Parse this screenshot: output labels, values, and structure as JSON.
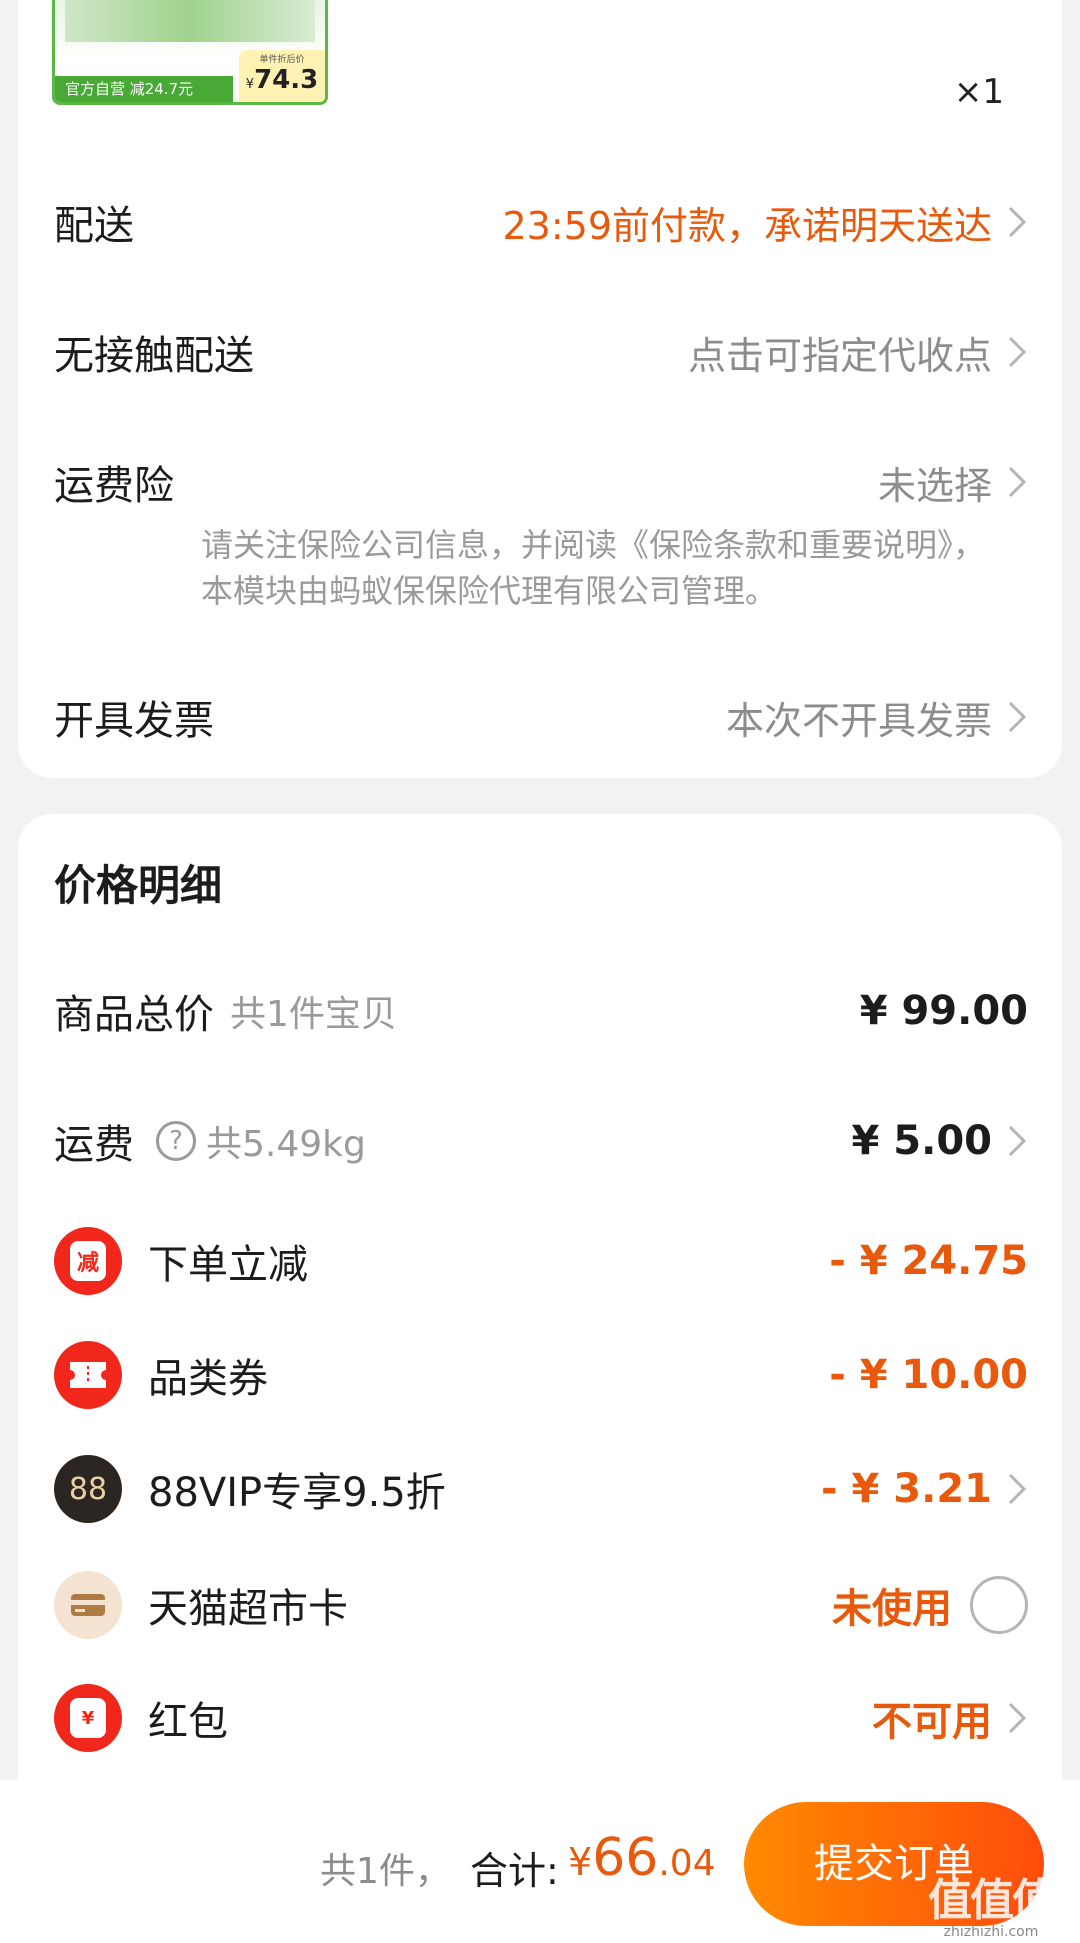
{
  "product": {
    "tag": "官方自营  减24.7元",
    "price_label": "单件折后价",
    "price_yen": "¥",
    "price": "74.3",
    "quantity": "×1"
  },
  "order_options": [
    {
      "label": "配送",
      "value": "23:59前付款，承诺明天送达"
    },
    {
      "label": "无接触配送",
      "value": "点击可指定代收点"
    },
    {
      "label": "运费险",
      "value": "未选择"
    },
    {
      "label": "开具发票",
      "value": "本次不开具发票"
    }
  ],
  "insurance_note": "请关注保险公司信息，并阅读《保险条款和重要说明》，本模块由蚂蚁保保险代理有限公司管理。",
  "price_detail": {
    "title": "价格明细",
    "goods_total": {
      "label": "商品总价",
      "sub": "共1件宝贝",
      "amount": "¥ 99.00"
    },
    "shipping": {
      "label": "运费",
      "help": "?",
      "sub": "共5.49kg",
      "amount": "¥ 5.00"
    },
    "discounts": [
      {
        "label": "下单立减",
        "icon_text": "减",
        "amount": "- ¥ 24.75"
      },
      {
        "label": "品类券",
        "icon_text": "",
        "amount": "- ¥ 10.00"
      },
      {
        "label": "88VIP专享9.5折",
        "icon_text": "88",
        "amount": "- ¥ 3.21"
      },
      {
        "label": "天猫超市卡",
        "icon_text": "",
        "amount": "未使用"
      },
      {
        "label": "红包",
        "icon_text": "¥",
        "amount": "不可用"
      }
    ]
  },
  "bottom_bar": {
    "count": "共1件，",
    "total_label": "合计:",
    "total_yen": "¥",
    "total_int": "66",
    "total_dec": ".04",
    "submit_label": "提交订单",
    "watermark": "值值值",
    "watermark_url": "zhizhizhi.com"
  },
  "colors": {
    "accent": "#e8590c",
    "badge_red": "#f2271c",
    "submit_start": "#ff8a00",
    "submit_end": "#ff4c0c"
  }
}
